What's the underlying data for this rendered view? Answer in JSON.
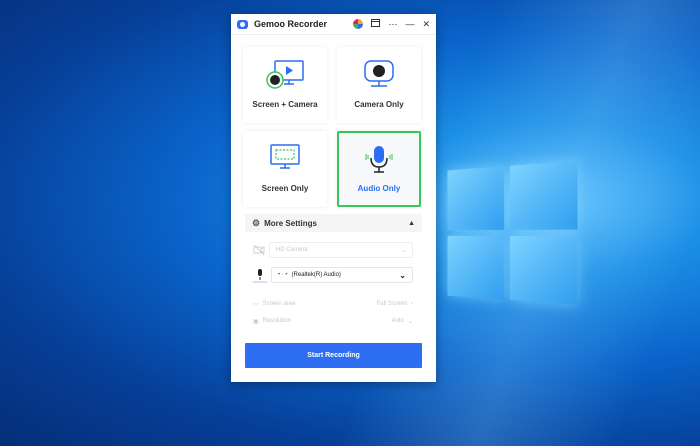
{
  "window": {
    "title": "Gemoo Recorder",
    "more_label": "⋯",
    "minimize_label": "—",
    "close_label": "✕"
  },
  "modes": [
    {
      "label": "Screen + Camera"
    },
    {
      "label": "Camera Only"
    },
    {
      "label": "Screen Only"
    },
    {
      "label": "Audio Only",
      "selected": true
    }
  ],
  "settings": {
    "title": "More Settings",
    "camera": "HD Camera",
    "microphone_prefix": "•  ·  •",
    "microphone": "(Realtek(R) Audio)",
    "screen_area_label": "Screen area",
    "screen_area_value": "Full Screen",
    "resolution_label": "Resolution",
    "resolution_value": "Auto"
  },
  "start_button": "Start Recording",
  "colors": {
    "accent": "#2e6ef2",
    "selected_border": "#35c75a"
  }
}
